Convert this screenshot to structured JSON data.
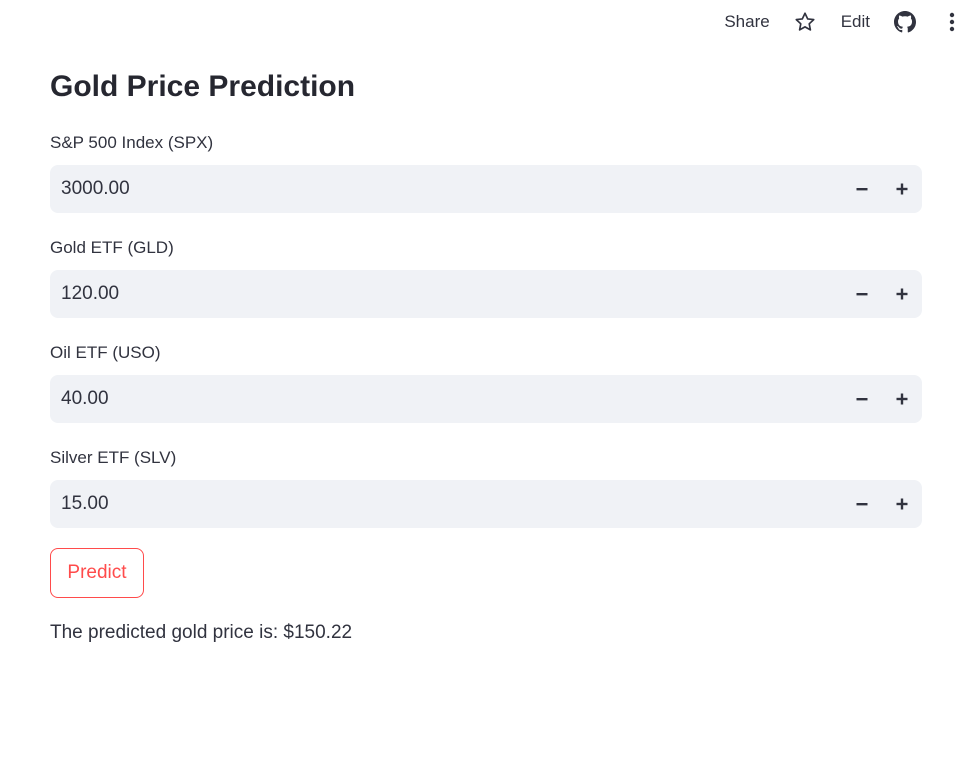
{
  "toolbar": {
    "share_label": "Share",
    "star_icon": "star-icon",
    "edit_label": "Edit",
    "github_icon": "github-icon",
    "menu_icon": "more-vertical-icon"
  },
  "page": {
    "title": "Gold Price Prediction"
  },
  "inputs": [
    {
      "label": "S&P 500 Index (SPX)",
      "value": "3000.00"
    },
    {
      "label": "Gold ETF (GLD)",
      "value": "120.00"
    },
    {
      "label": "Oil ETF (USO)",
      "value": "40.00"
    },
    {
      "label": "Silver ETF (SLV)",
      "value": "15.00"
    }
  ],
  "stepper": {
    "minus_icon": "minus-icon",
    "plus_icon": "plus-icon"
  },
  "predict": {
    "label": "Predict"
  },
  "result": {
    "text": "The predicted gold price is: $150.22"
  },
  "colors": {
    "accent": "#ff4b4b",
    "text": "#31333f",
    "input_bg": "#f0f2f6"
  }
}
